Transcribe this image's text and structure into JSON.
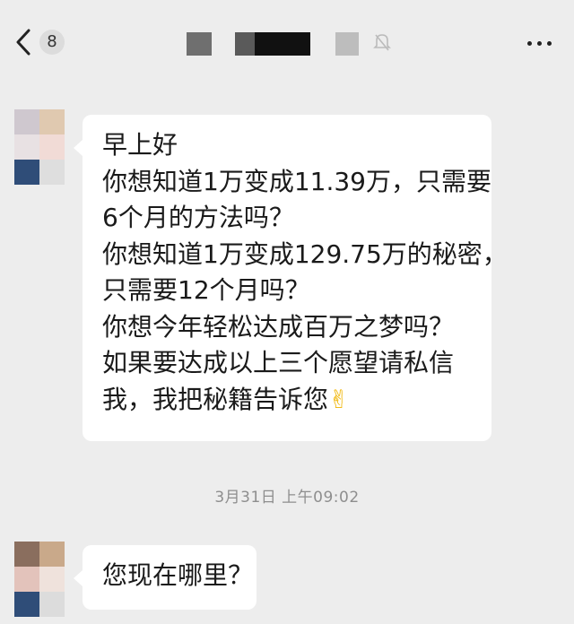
{
  "header": {
    "back_icon": "chevron-left-icon",
    "unread_count": "8",
    "bell_icon": "bell-muted-icon",
    "more_icon": "more-dots-icon"
  },
  "messages": [
    {
      "lines": [
        "早上好",
        "你想知道1万变成11.39万，只需要",
        "6个月的方法吗？",
        "你想知道1万变成129.75万的秘密，",
        "只需要12个月吗？",
        "你想今年轻松达成百万之梦吗？",
        "如果要达成以上三个愿望请私信",
        "我，我把秘籍告诉您"
      ],
      "emoji": "✌"
    },
    {
      "lines": [
        "您现在哪里？"
      ]
    }
  ],
  "timestamp": "3月31日 上午09:02",
  "colors": {
    "background": "#ededed",
    "bubble": "#ffffff",
    "timestamp": "#8e8e8e"
  }
}
